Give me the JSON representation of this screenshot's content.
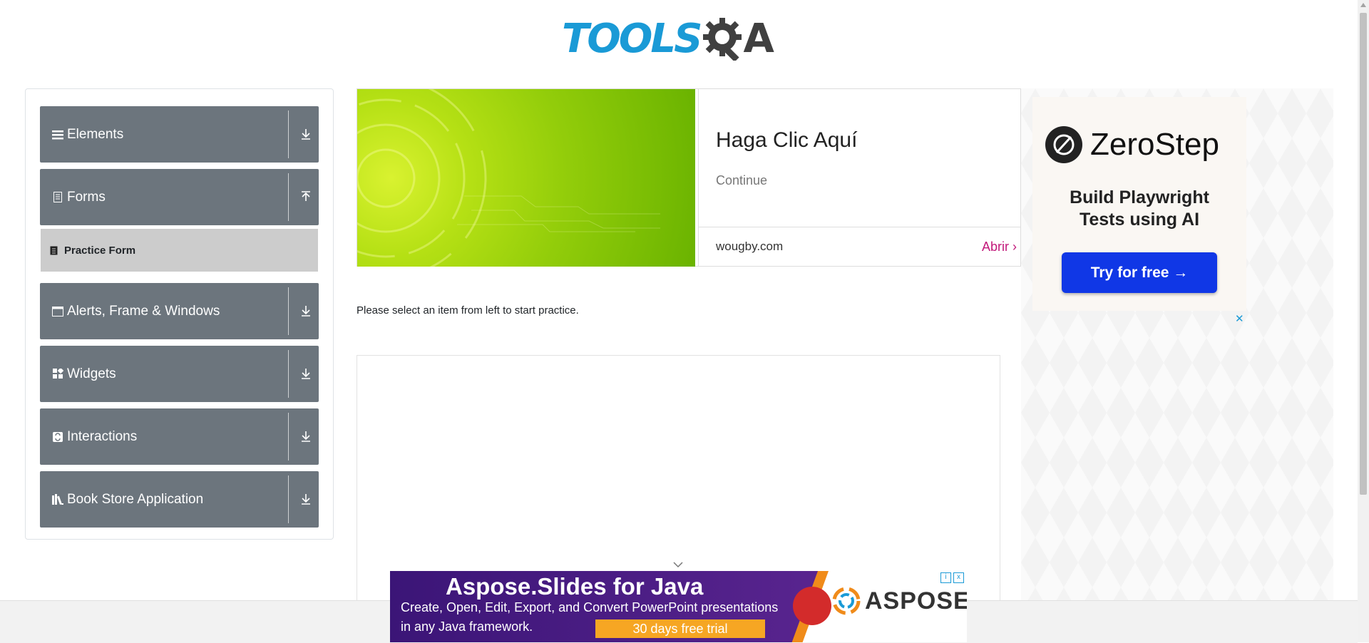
{
  "header": {
    "logo_main": "TOOLS",
    "logo_suffix": "A"
  },
  "sidebar": {
    "groups": [
      {
        "label": "Elements",
        "icon": "hamburger-icon",
        "arrow": "download"
      },
      {
        "label": "Forms",
        "icon": "document-icon",
        "arrow": "upload"
      },
      {
        "label": "Alerts, Frame & Windows",
        "icon": "window-icon",
        "arrow": "download"
      },
      {
        "label": "Widgets",
        "icon": "widgets-icon",
        "arrow": "download"
      },
      {
        "label": "Interactions",
        "icon": "interactions-icon",
        "arrow": "download"
      },
      {
        "label": "Book Store Application",
        "icon": "books-icon",
        "arrow": "download"
      }
    ],
    "forms_items": [
      {
        "label": "Practice Form",
        "icon": "form-icon"
      }
    ]
  },
  "ad_banner": {
    "title": "Haga Clic Aquí",
    "subtitle": "Continue",
    "domain": "wougby.com",
    "cta": "Abrir"
  },
  "main": {
    "instruction": "Please select an item from left to start practice."
  },
  "right_ad": {
    "brand": "ZeroStep",
    "tagline_line1": "Build Playwright",
    "tagline_line2": "Tests using AI",
    "button": "Try for free →",
    "close": "✕"
  },
  "bottom_ad": {
    "headline": "Aspose.Slides for Java",
    "desc_line1": "Create, Open, Edit, Export, and Convert PowerPoint presentations",
    "desc_line2": "in any Java framework.",
    "trial": "30 days free trial",
    "brand": "ASPOSE"
  },
  "colors": {
    "accent": "#1a9ad6",
    "sidebar_bg": "#6c757d",
    "sub_bg": "#cccccc",
    "zerostep_btn": "#1037e6",
    "abrir": "#c2187a"
  }
}
